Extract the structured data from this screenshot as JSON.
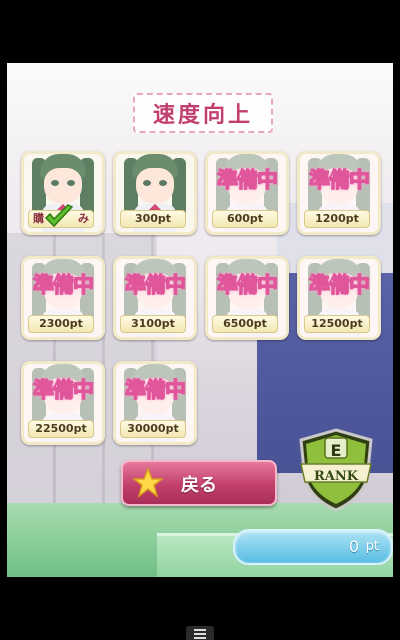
{
  "screen": {
    "title": "速度向上"
  },
  "tiles": [
    {
      "status": "purchased",
      "label_left": "購",
      "label_right": "み",
      "price": ""
    },
    {
      "status": "available",
      "price": "300pt"
    },
    {
      "status": "locked",
      "locked_text": "準備中",
      "price": "600pt"
    },
    {
      "status": "locked",
      "locked_text": "準備中",
      "price": "1200pt"
    },
    {
      "status": "locked",
      "locked_text": "準備中",
      "price": "2300pt"
    },
    {
      "status": "locked",
      "locked_text": "準備中",
      "price": "3100pt"
    },
    {
      "status": "locked",
      "locked_text": "準備中",
      "price": "6500pt"
    },
    {
      "status": "locked",
      "locked_text": "準備中",
      "price": "12500pt"
    },
    {
      "status": "locked",
      "locked_text": "準備中",
      "price": "22500pt"
    },
    {
      "status": "locked",
      "locked_text": "準備中",
      "price": "30000pt"
    }
  ],
  "back_button": {
    "label": "戻る",
    "icon": "star-icon"
  },
  "rank": {
    "letter": "E",
    "label": "RANK"
  },
  "points": {
    "value": "0",
    "unit": "pt"
  },
  "colors": {
    "accent_pink": "#c2406b",
    "title_pink": "#c23e6e",
    "points_blue": "#58bde2",
    "rank_green": "#7fb03a"
  }
}
